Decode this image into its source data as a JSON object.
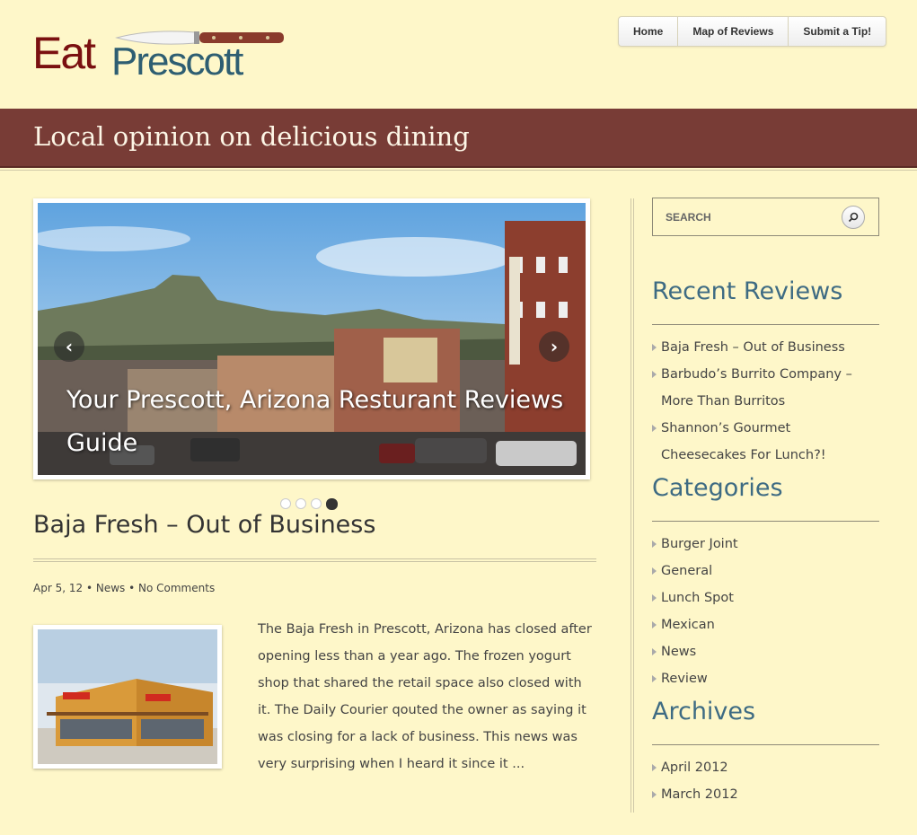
{
  "brand": {
    "logo_part1": "Eat",
    "logo_part2": "Prescott",
    "colors": {
      "eat": "#7a1010",
      "prescott": "#2e5e72"
    }
  },
  "nav": {
    "items": [
      {
        "label": "Home"
      },
      {
        "label": "Map of Reviews"
      },
      {
        "label": "Submit a Tip!"
      }
    ]
  },
  "tagline": "Local opinion on delicious dining",
  "slider": {
    "caption": "Your Prescott, Arizona Resturant Reviews Guide",
    "prev_icon": "chevron-left-icon",
    "next_icon": "chevron-right-icon",
    "slide_count": 4,
    "active_slide": 4
  },
  "post": {
    "title": "Baja Fresh – Out of Business",
    "date": "Apr 5, 12",
    "category": "News",
    "comments": "No Comments",
    "excerpt": "The Baja Fresh in Prescott, Arizona has closed after opening less than a year ago. The frozen yogurt shop that shared the retail space also closed with it. The Daily Courier qouted the owner as saying it was closing for a lack of business. This news was very surprising when I heard it since it ..."
  },
  "sidebar": {
    "search_placeholder": "SEARCH",
    "recent_title": "Recent Reviews",
    "recent": [
      {
        "label": "Baja Fresh – Out of Business"
      },
      {
        "label": "Barbudo’s Burrito Company – More Than Burritos"
      },
      {
        "label": "Shannon’s Gourmet Cheesecakes For Lunch?!"
      }
    ],
    "categories_title": "Categories",
    "categories": [
      {
        "label": "Burger Joint"
      },
      {
        "label": "General"
      },
      {
        "label": "Lunch Spot"
      },
      {
        "label": "Mexican"
      },
      {
        "label": "News"
      },
      {
        "label": "Review"
      }
    ],
    "archives_title": "Archives",
    "archives": [
      {
        "label": "April 2012"
      },
      {
        "label": "March 2012"
      }
    ]
  },
  "colors": {
    "background": "#fef7c9",
    "tagbar": "#783c36",
    "widget_title": "#3e6b83"
  }
}
